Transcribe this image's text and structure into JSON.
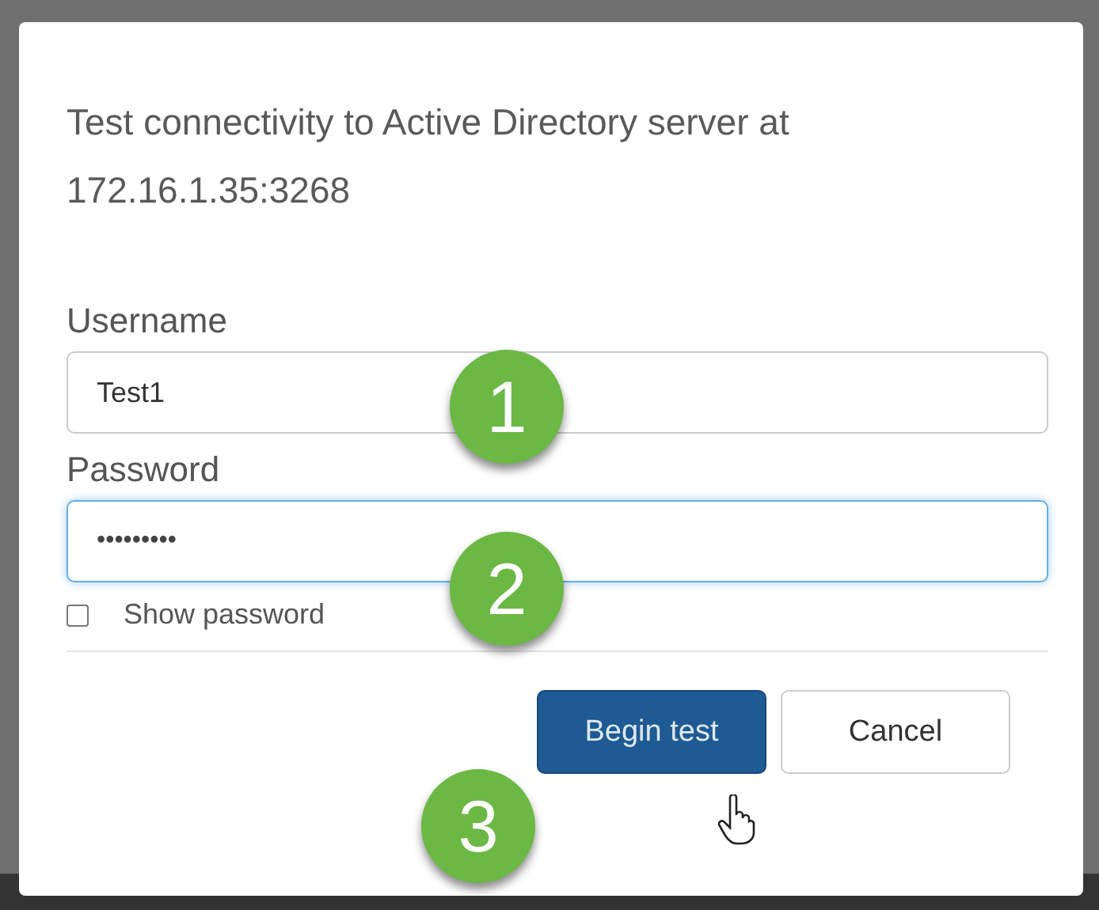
{
  "dialog": {
    "message": "Test connectivity to Active Directory server at 172.16.1.35:3268",
    "fields": [
      {
        "label": "Username",
        "value": "Test1",
        "focused": false
      },
      {
        "label": "Password",
        "value": "•••••••••",
        "focused": true
      }
    ],
    "show_password": {
      "label": "Show password",
      "checked": false
    },
    "buttons": [
      {
        "label": "Begin test",
        "kind": "primary"
      },
      {
        "label": "Cancel",
        "kind": "default"
      }
    ]
  },
  "callouts": [
    {
      "label": "1"
    },
    {
      "label": "2"
    },
    {
      "label": "3"
    }
  ]
}
